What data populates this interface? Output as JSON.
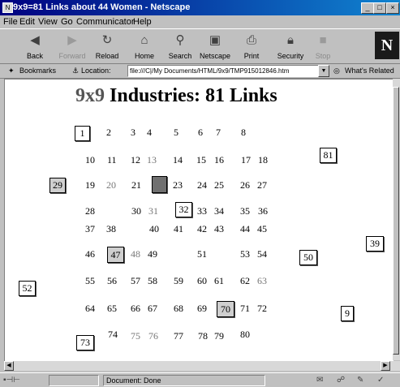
{
  "window": {
    "title": "9x9=81 Links about 44 Women - Netscape",
    "buttons": [
      "_",
      "□",
      "×"
    ]
  },
  "menu": [
    "File",
    "Edit",
    "View",
    "Go",
    "Communicator",
    "Help"
  ],
  "toolbar": {
    "back": "Back",
    "forward": "Forward",
    "reload": "Reload",
    "home": "Home",
    "search": "Search",
    "netscape": "Netscape",
    "print": "Print",
    "security": "Security",
    "stop": "Stop",
    "logo": "N"
  },
  "location": {
    "bookmarks": "Bookmarks",
    "label": "Location:",
    "url": "file:///C|/My Documents/HTML/9x9/TMP915012846.htm",
    "related": "What's Related"
  },
  "page": {
    "title_prefix": "9x9",
    "title_rest": " Industries: 81 Links",
    "numbers": [
      "2",
      "3",
      "4",
      "5",
      "6",
      "7",
      "8",
      "10",
      "11",
      "12",
      "13",
      "14",
      "15",
      "16",
      "17",
      "18",
      "19",
      "20",
      "21",
      "23",
      "24",
      "25",
      "26",
      "27",
      "28",
      "30",
      "31",
      "33",
      "34",
      "35",
      "36",
      "37",
      "38",
      "40",
      "41",
      "42",
      "43",
      "44",
      "45",
      "46",
      "48",
      "49",
      "51",
      "53",
      "54",
      "55",
      "56",
      "57",
      "58",
      "59",
      "60",
      "61",
      "62",
      "63",
      "64",
      "65",
      "66",
      "67",
      "68",
      "69",
      "71",
      "72",
      "74",
      "75",
      "76",
      "77",
      "78",
      "79",
      "80"
    ],
    "boxed": [
      "1",
      "22",
      "29",
      "32",
      "39",
      "47",
      "50",
      "52",
      "70",
      "73",
      "81",
      "9"
    ]
  },
  "status": {
    "text": "Document: Done"
  }
}
